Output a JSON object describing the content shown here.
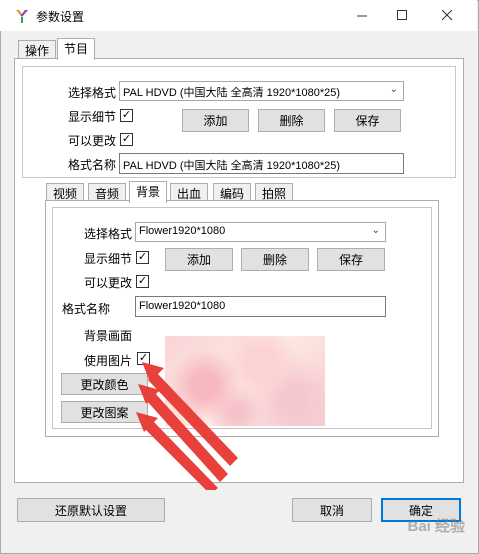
{
  "window": {
    "title": "参数设置",
    "minimize_icon": "minimize-icon",
    "maximize_icon": "maximize-icon",
    "close_icon": "close-icon"
  },
  "main_tabs": [
    {
      "label": "操作",
      "active": false
    },
    {
      "label": "节目",
      "active": true
    }
  ],
  "program": {
    "select_format_label": "选择格式",
    "select_format_value": "PAL HDVD (中国大陆 全高清 1920*1080*25)",
    "show_details_label": "显示细节",
    "show_details_checked": true,
    "editable_label": "可以更改",
    "editable_checked": true,
    "add_label": "添加",
    "delete_label": "删除",
    "save_label": "保存",
    "format_name_label": "格式名称",
    "format_name_value": "PAL HDVD (中国大陆 全高清 1920*1080*25)"
  },
  "sub_tabs": [
    {
      "label": "视频",
      "active": false
    },
    {
      "label": "音频",
      "active": false
    },
    {
      "label": "背景",
      "active": true
    },
    {
      "label": "出血",
      "active": false
    },
    {
      "label": "编码",
      "active": false
    },
    {
      "label": "拍照",
      "active": false
    }
  ],
  "background": {
    "select_format_label": "选择格式",
    "select_format_value": "Flower1920*1080",
    "show_details_label": "显示细节",
    "show_details_checked": true,
    "editable_label": "可以更改",
    "editable_checked": true,
    "add_label": "添加",
    "delete_label": "删除",
    "save_label": "保存",
    "format_name_label": "格式名称",
    "format_name_value": "Flower1920*1080",
    "bg_picture_label": "背景画面",
    "use_picture_label": "使用图片",
    "use_picture_checked": true,
    "change_color_label": "更改颜色",
    "change_pattern_label": "更改图案"
  },
  "footer": {
    "restore_defaults_label": "还原默认设置",
    "cancel_label": "取消",
    "ok_label": "确定"
  },
  "watermark_text": "Bai 经验",
  "colors": {
    "annotation_arrow": "#e8413c",
    "accent": "#0078d7"
  }
}
